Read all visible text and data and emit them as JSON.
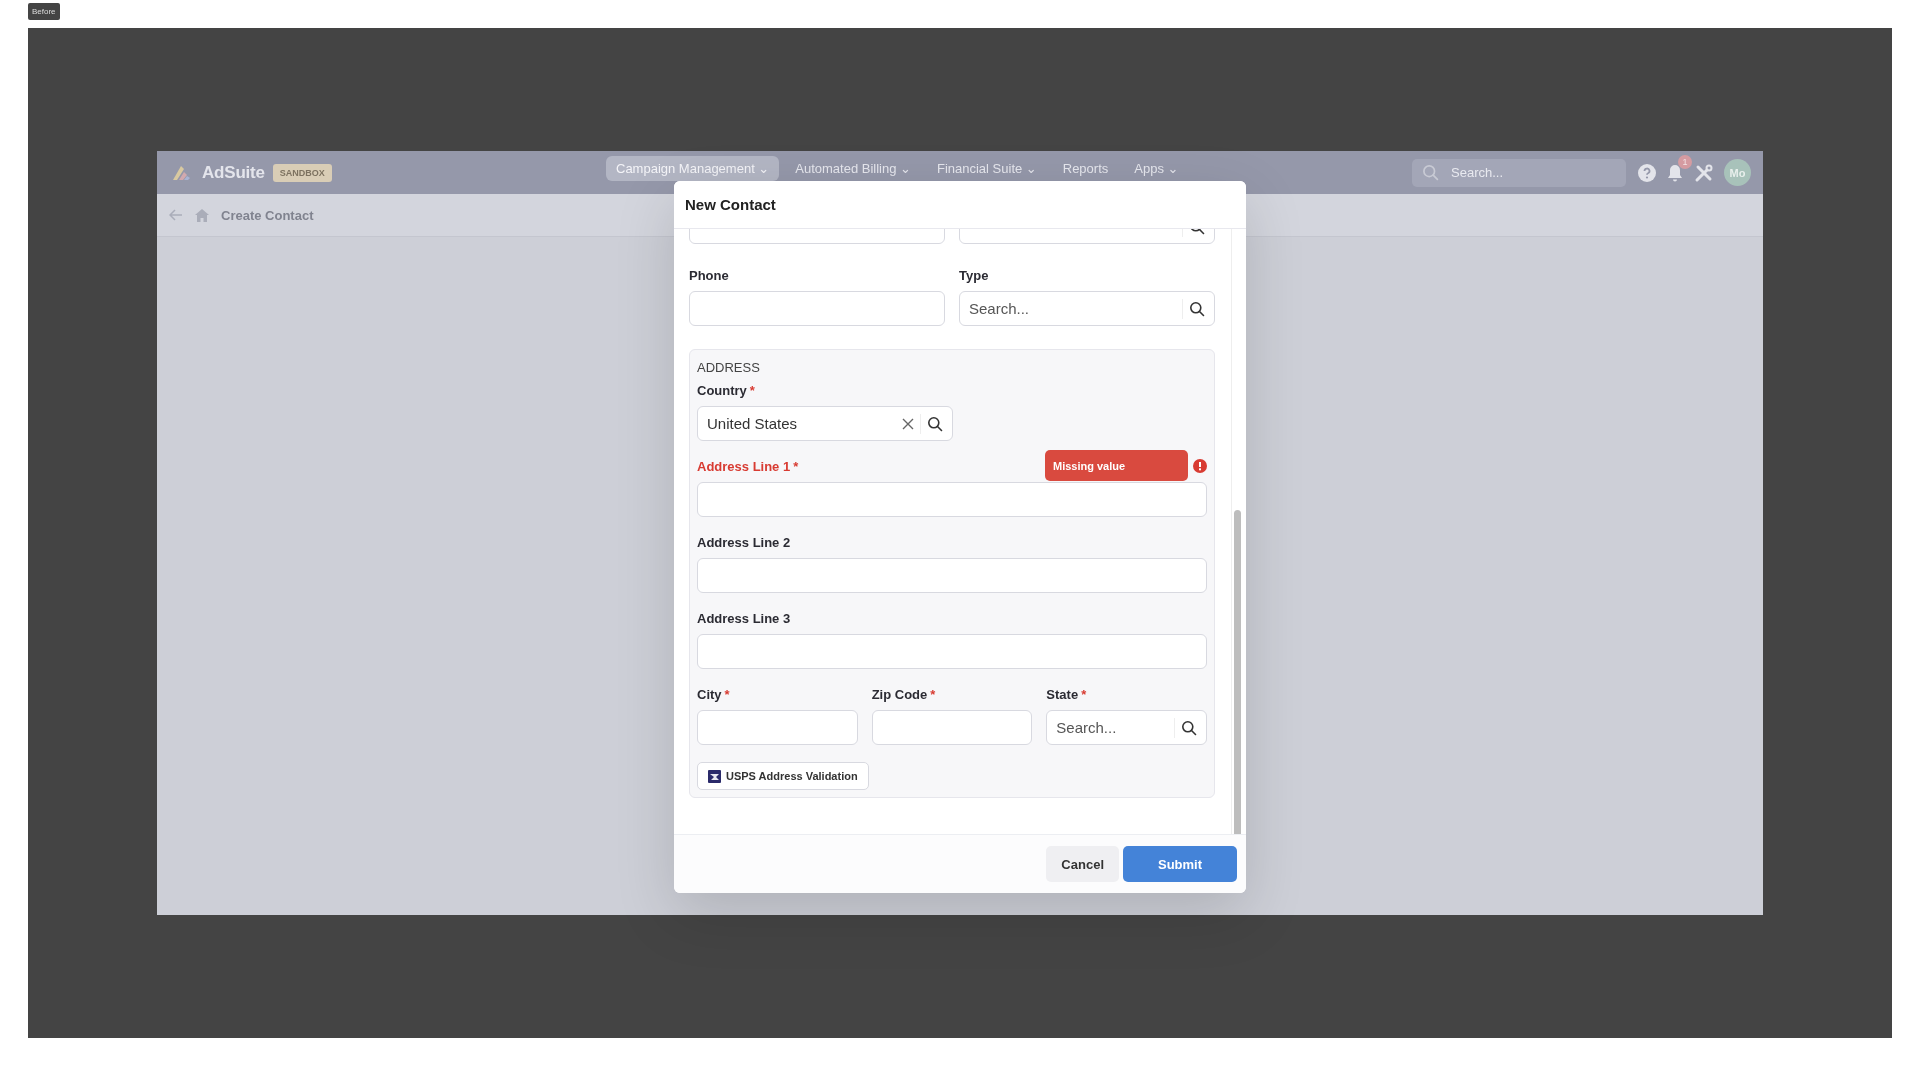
{
  "tag": "Before",
  "app": {
    "brand": "AdSuite",
    "badge": "SANDBOX",
    "nav": [
      {
        "label": "Campaign Management",
        "caret": "⌄",
        "selected": true
      },
      {
        "label": "Automated Billing",
        "caret": "⌄",
        "selected": false
      },
      {
        "label": "Financial Suite",
        "caret": "⌄",
        "selected": false
      },
      {
        "label": "Reports",
        "selected": false
      },
      {
        "label": "Apps",
        "caret": "⌄",
        "selected": false
      }
    ],
    "search": {
      "placeholder": "Search..."
    },
    "notifications": "1",
    "avatar": "Mo"
  },
  "breadcrumb": {
    "title": "Create Contact"
  },
  "modal": {
    "title": "New Contact",
    "rows": [
      [
        {
          "kind": "text"
        },
        {
          "kind": "search"
        }
      ],
      [
        {
          "kind": "text",
          "label": "Phone"
        },
        {
          "kind": "search",
          "label": "Type",
          "placeholder": "Search..."
        }
      ]
    ],
    "address": {
      "heading": "ADDRESS",
      "rows": [
        [
          {
            "kind": "lookup",
            "label": "Country",
            "required_mark": "*",
            "value": "United States"
          }
        ],
        [
          {
            "kind": "text",
            "label": "Address Line 1",
            "required_mark": "*",
            "error": "Missing value"
          }
        ],
        [
          {
            "kind": "text",
            "label": "Address Line 2"
          }
        ],
        [
          {
            "kind": "text",
            "label": "Address Line 3"
          }
        ],
        [
          {
            "kind": "text",
            "label": "City",
            "required_mark": "*"
          },
          {
            "kind": "text",
            "label": "Zip Code",
            "required_mark": "*"
          },
          {
            "kind": "search",
            "label": "State",
            "required_mark": "*",
            "placeholder": "Search..."
          }
        ]
      ],
      "button": "USPS Address Validation"
    },
    "buttons": [
      {
        "label": "Cancel",
        "kind": "secondary"
      },
      {
        "label": "Submit",
        "kind": "primary"
      }
    ]
  }
}
